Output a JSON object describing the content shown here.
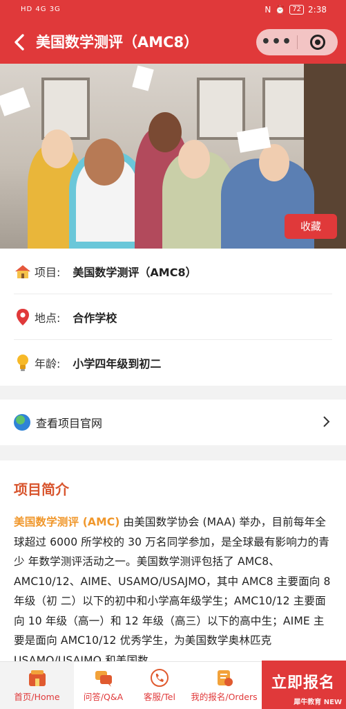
{
  "status": {
    "left": "HD 4G 3G",
    "time": "2:38",
    "battery": "72"
  },
  "header": {
    "title": "美国数学测评（AMC8）",
    "more": "•••"
  },
  "banner": {
    "favorite_label": "收藏"
  },
  "info": {
    "project": {
      "label": "项目:",
      "value": "美国数学测评（AMC8）"
    },
    "location": {
      "label": "地点:",
      "value": "合作学校"
    },
    "age": {
      "label": "年龄:",
      "value": "小学四年级到初二"
    }
  },
  "website": {
    "label": "查看项目官网"
  },
  "intro": {
    "heading": "项目简介",
    "highlight": "美国数学测评 (AMC)",
    "body": " 由美国数学协会 (MAA) 举办，目前每年全球超过 6000 所学校的 30 万名同学参加，是全球最有影响力的青少 年数学测评活动之一。美国数学测评包括了 AMC8、AMC10/12、AIME、USAMO/USAJMO，其中 AMC8 主要面向 8 年级（初 二）以下的初中和小学高年级学生；AMC10/12 主要面向 10 年级（高一）和 12 年级（高三）以下的高中生；AIME 主要是面向 AMC10/12 优秀学生，为美国数学奥林匹克 USAMO/USAJMO 和美国数"
  },
  "tabbar": {
    "home": "首页/Home",
    "qa": "问答/Q&A",
    "service": "客服/Tel",
    "orders": "我的报名/Orders",
    "signup": "立即报名",
    "watermark": "犀牛教育 NEW"
  },
  "colors": {
    "brand": "#e0393a",
    "heading": "#d8552e",
    "highlight": "#f0972b"
  }
}
